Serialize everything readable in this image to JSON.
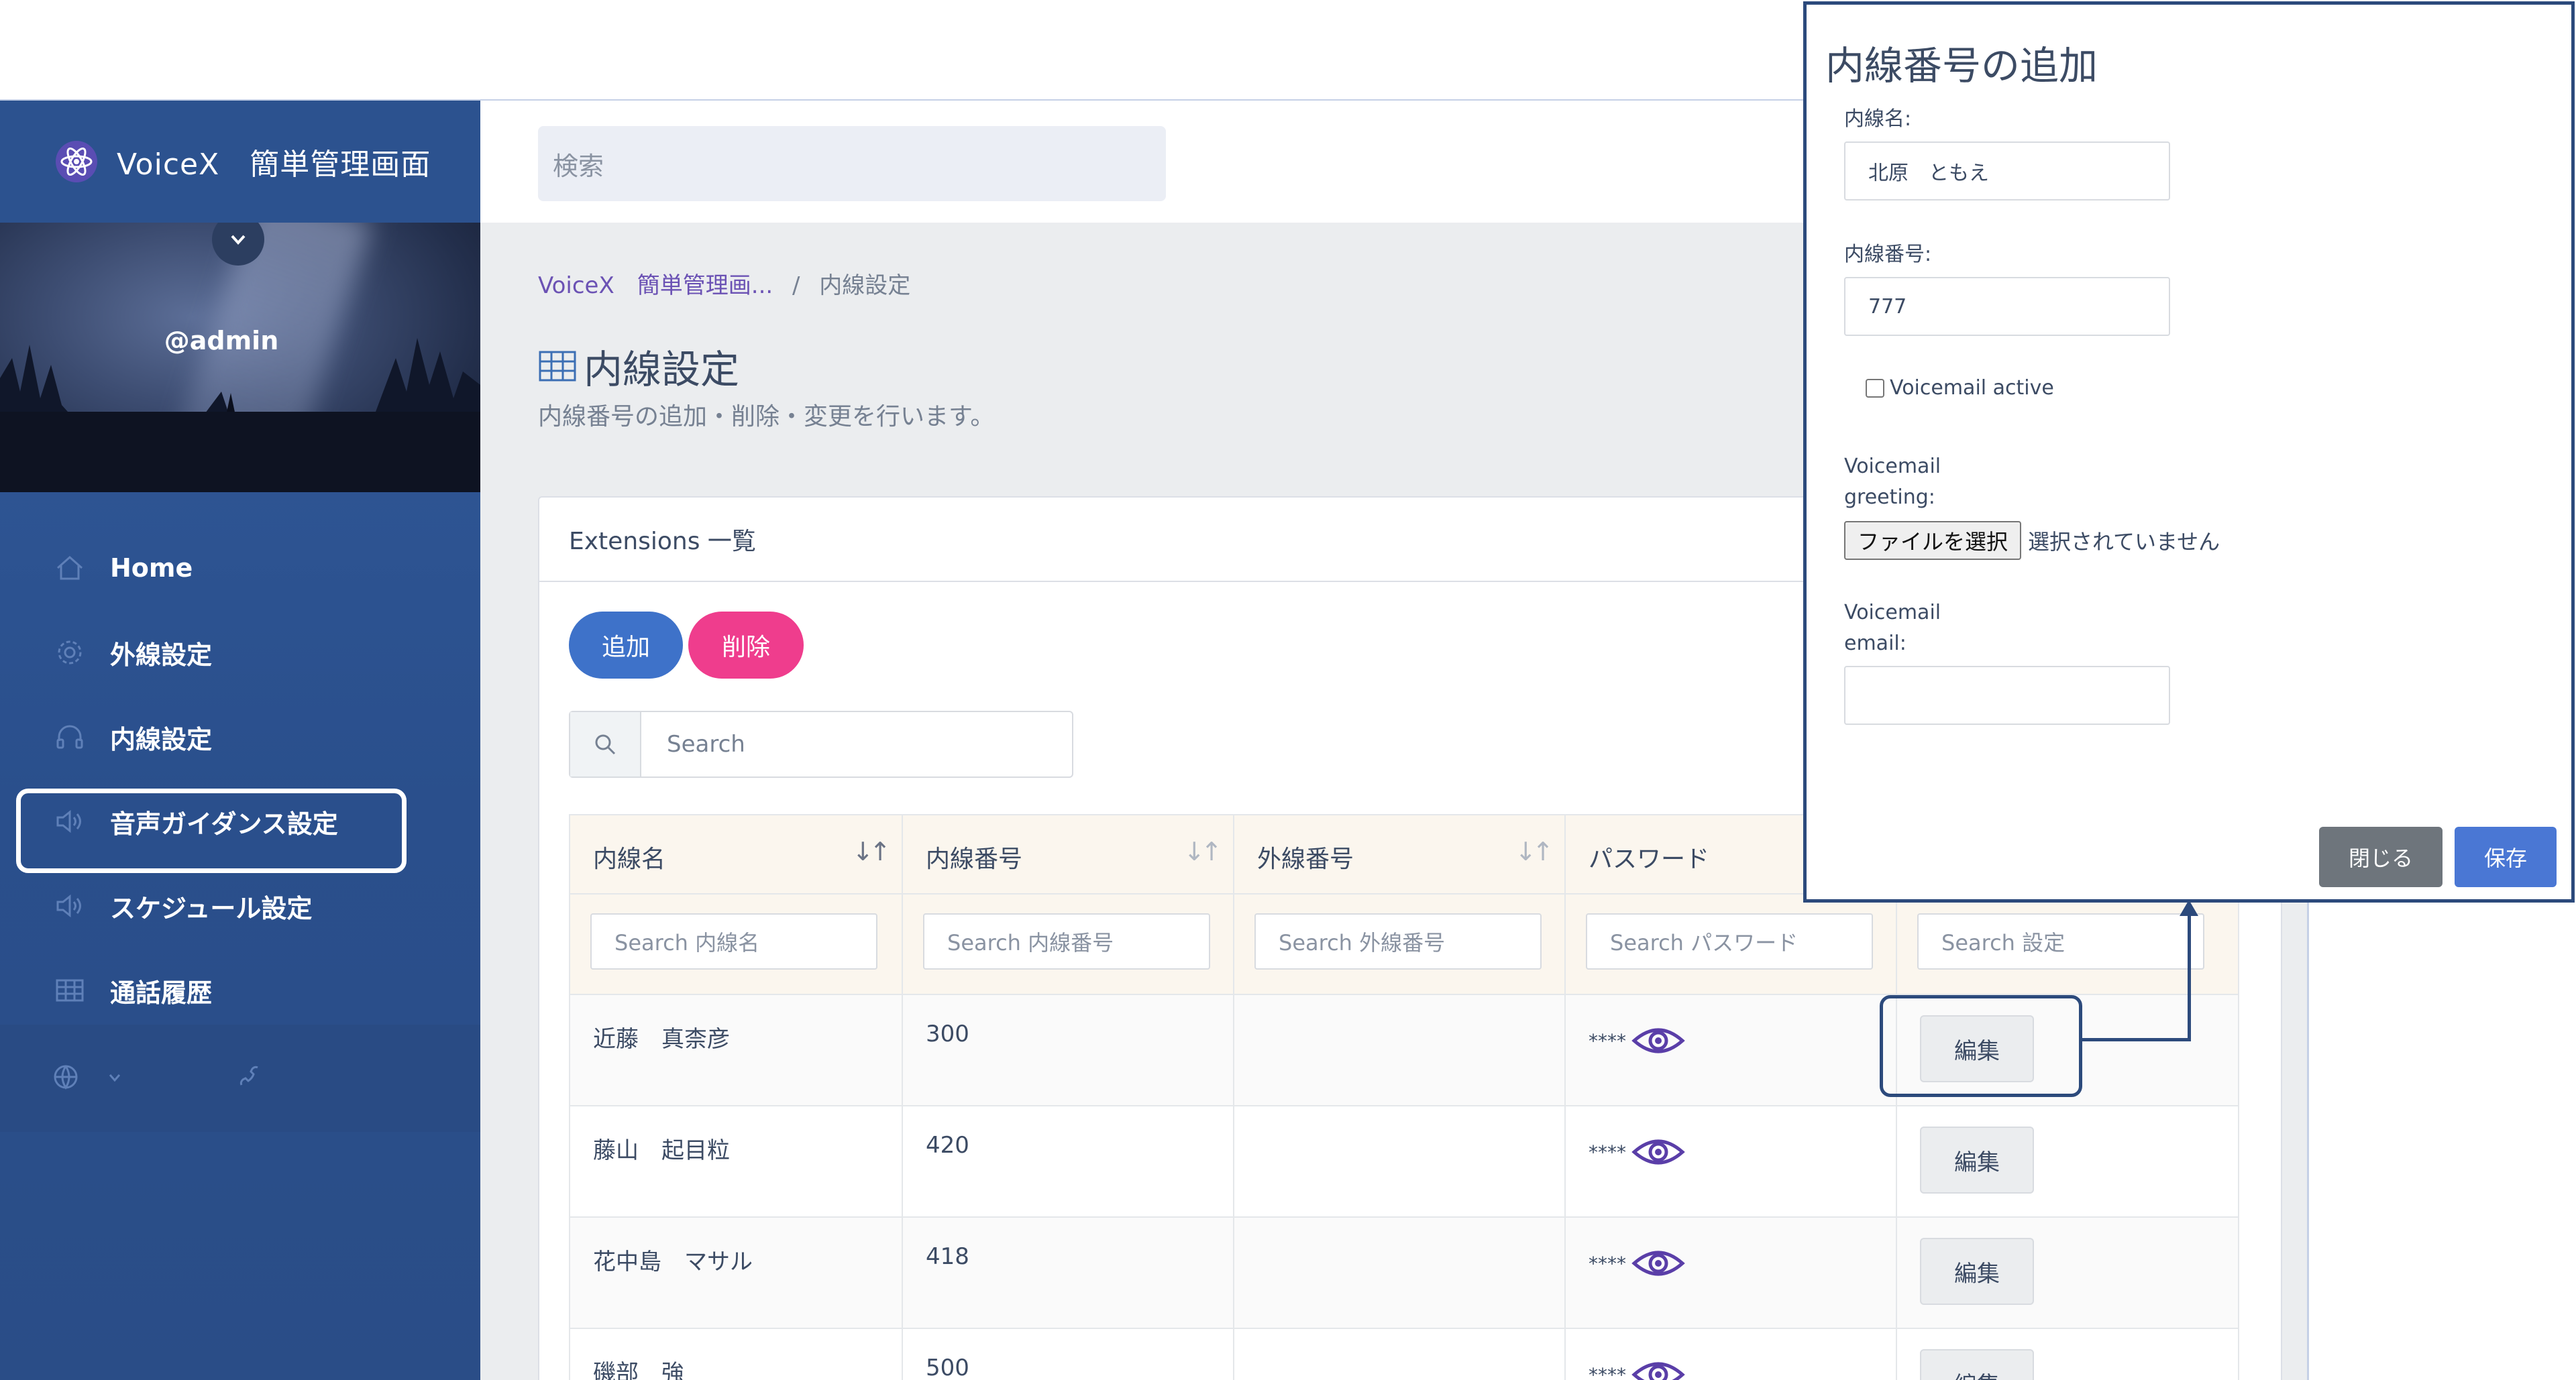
{
  "brand": {
    "name": "VoiceX　簡単管理画面",
    "logo_icon": "atom-icon"
  },
  "profile": {
    "username": "@admin"
  },
  "sidebar": {
    "items": [
      {
        "label": "Home",
        "icon": "home-icon"
      },
      {
        "label": "外線設定",
        "icon": "gear-icon"
      },
      {
        "label": "内線設定",
        "icon": "headset-icon"
      },
      {
        "label": "音声ガイダンス設定",
        "icon": "speaker-icon"
      },
      {
        "label": "スケジュール設定",
        "icon": "speaker-icon"
      },
      {
        "label": "通話履歴",
        "icon": "table-icon"
      }
    ],
    "footer_icons": [
      "globe-icon",
      "chevron-down-icon",
      "phone-icon"
    ]
  },
  "header": {
    "search_placeholder": "検索"
  },
  "breadcrumb": {
    "home": "VoiceX　簡単管理画...",
    "separator": "/",
    "current": "内線設定"
  },
  "page": {
    "title": "内線設定",
    "subtitle": "内線番号の追加・削除・変更を行います。"
  },
  "card": {
    "title": "Extensions 一覧",
    "add_label": "追加",
    "delete_label": "削除",
    "search_placeholder": "Search"
  },
  "table": {
    "columns": [
      {
        "label": "内線名",
        "filter": "Search 内線名"
      },
      {
        "label": "内線番号",
        "filter": "Search 内線番号"
      },
      {
        "label": "外線番号",
        "filter": "Search 外線番号"
      },
      {
        "label": "パスワード",
        "filter": "Search パスワード"
      },
      {
        "label": "",
        "filter": "Search 設定"
      }
    ],
    "rows": [
      {
        "name": "近藤　真柰彦",
        "number": "300",
        "outside": "",
        "password": "****",
        "action": "編集"
      },
      {
        "name": "藤山　起目粒",
        "number": "420",
        "outside": "",
        "password": "****",
        "action": "編集"
      },
      {
        "name": "花中島　マサル",
        "number": "418",
        "outside": "",
        "password": "****",
        "action": "編集"
      },
      {
        "name": "磯部　強",
        "number": "500",
        "outside": "",
        "password": "****",
        "action": "編集"
      }
    ]
  },
  "modal": {
    "title": "内線番号の追加",
    "name_label": "内線名:",
    "name_value": "北原　ともえ",
    "number_label": "内線番号:",
    "number_value": "777",
    "voicemail_active_label": "Voicemail active",
    "voicemail_active_checked": false,
    "greeting_label_1": "Voicemail",
    "greeting_label_2": "greeting:",
    "file_button": "ファイルを選択",
    "file_status": "選択されていません",
    "email_label_1": "Voicemail",
    "email_label_2": "email:",
    "email_value": "",
    "close_label": "閉じる",
    "save_label": "保存"
  },
  "colors": {
    "sidebar": "#2c528f",
    "primary": "#3e72c9",
    "danger": "#ef3d8d",
    "callout": "#2c4a7c"
  }
}
